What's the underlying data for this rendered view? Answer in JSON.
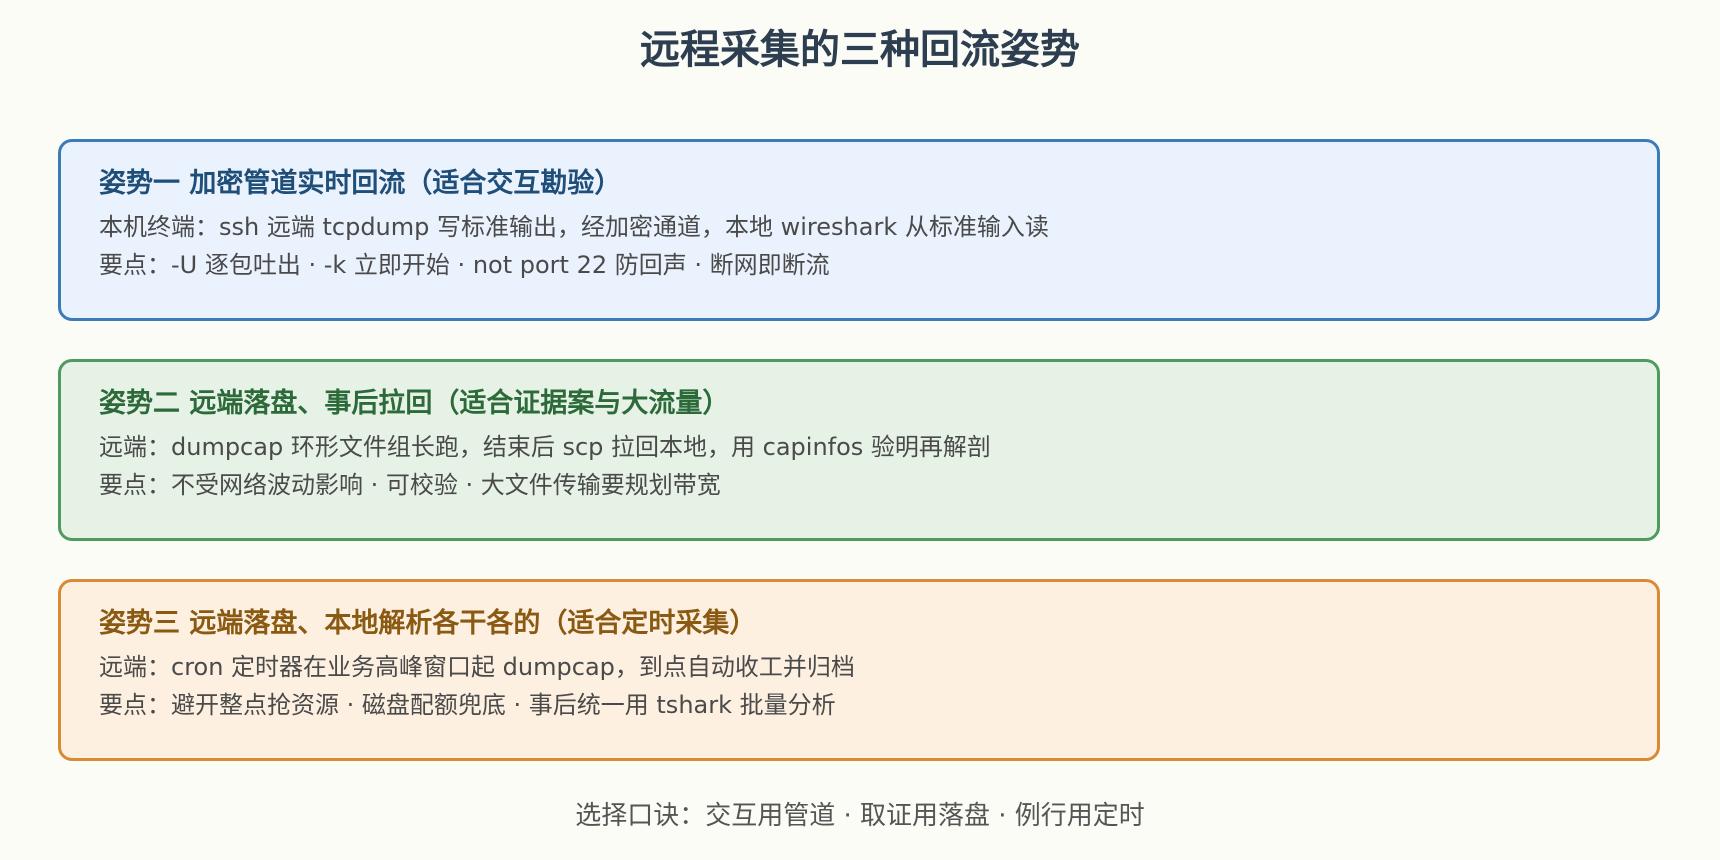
{
  "title": "远程采集的三种回流姿势",
  "cards": [
    {
      "title": "姿势一 加密管道实时回流（适合交互勘验）",
      "line1": "本机终端：ssh 远端 tcpdump 写标准输出，经加密通道，本地 wireshark 从标准输入读",
      "line2": "要点：-U 逐包吐出 · -k 立即开始 · not port 22 防回声 · 断网即断流",
      "border_color": "#3d7ab8",
      "background_color": "#eaf2fd",
      "title_color": "#1f4e79"
    },
    {
      "title": "姿势二 远端落盘、事后拉回（适合证据案与大流量）",
      "line1": "远端：dumpcap 环形文件组长跑，结束后 scp 拉回本地，用 capinfos 验明再解剖",
      "line2": "要点：不受网络波动影响 · 可校验 · 大文件传输要规划带宽",
      "border_color": "#4e9a5f",
      "background_color": "#e7f2e7",
      "title_color": "#2d6a3a"
    },
    {
      "title": "姿势三 远端落盘、本地解析各干各的（适合定时采集）",
      "line1": "远端：cron 定时器在业务高峰窗口起 dumpcap，到点自动收工并归档",
      "line2": "要点：避开整点抢资源 · 磁盘配额兜底 · 事后统一用 tshark 批量分析",
      "border_color": "#d88a35",
      "background_color": "#fdf0e1",
      "title_color": "#8a5a12"
    }
  ],
  "footer": "选择口诀：交互用管道 · 取证用落盘 · 例行用定时"
}
